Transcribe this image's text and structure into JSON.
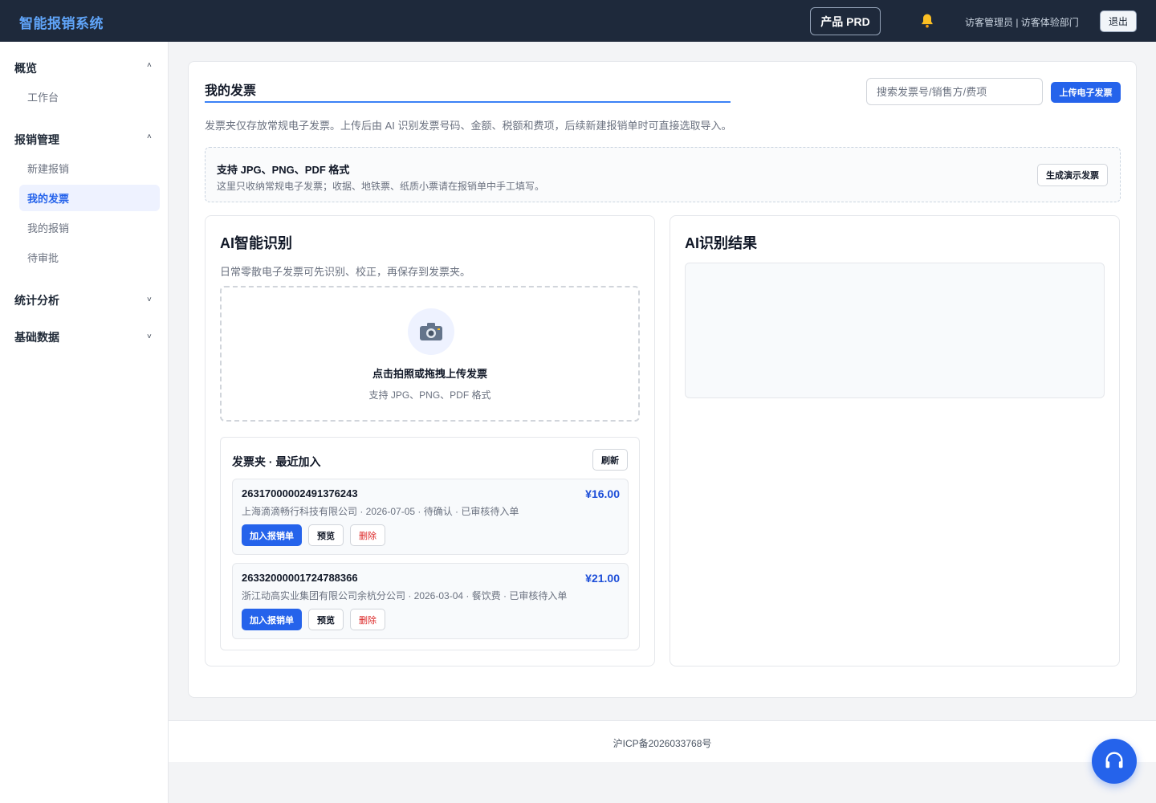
{
  "header": {
    "brand": "智能报销系统",
    "prd_label": "产品 PRD",
    "bell_icon": "bell-icon",
    "user": "访客管理员 | 访客体验部门",
    "logout": "退出"
  },
  "sidebar": {
    "groups": [
      {
        "title": "概览",
        "expanded": true,
        "items": [
          "工作台"
        ]
      },
      {
        "title": "报销管理",
        "expanded": true,
        "items": [
          "新建报销",
          "我的发票",
          "我的报销",
          "待审批"
        ]
      },
      {
        "title": "统计分析",
        "expanded": false,
        "items": []
      },
      {
        "title": "基础数据",
        "expanded": false,
        "items": []
      }
    ],
    "active_item": "我的发票",
    "chev_up": "˄",
    "chev_down": "˅"
  },
  "page": {
    "title": "我的发票",
    "search_placeholder": "搜索发票号/销售方/费项",
    "upload_btn": "上传电子发票",
    "desc": "发票夹仅存放常规电子发票。上传后由 AI 识别发票号码、金额、税额和费项，后续新建报销单时可直接选取导入。",
    "format_title": "支持 JPG、PNG、PDF 格式",
    "format_sub": "这里只收纳常规电子发票；收据、地铁票、纸质小票请在报销单中手工填写。",
    "demo_btn": "生成演示发票"
  },
  "ai_panel": {
    "title": "AI智能识别",
    "desc": "日常零散电子发票可先识别、校正，再保存到发票夹。",
    "drop_title": "点击拍照或拖拽上传发票",
    "drop_sub": "支持 JPG、PNG、PDF 格式",
    "camera_icon": "camera-icon"
  },
  "folder": {
    "title": "发票夹 · 最近加入",
    "refresh": "刷新",
    "invoices": [
      {
        "number": "26317000002491376243",
        "amount": "¥16.00",
        "meta": "上海滴滴畅行科技有限公司 · 2026-07-05 · 待确认 · 已审核待入单",
        "add": "加入报销单",
        "preview": "预览",
        "delete": "删除"
      },
      {
        "number": "26332000001724788366",
        "amount": "¥21.00",
        "meta": "浙江动高实业集团有限公司余杭分公司 · 2026-03-04 · 餐饮费 · 已审核待入单",
        "add": "加入报销单",
        "preview": "预览",
        "delete": "删除"
      }
    ]
  },
  "result_panel": {
    "title": "AI识别结果"
  },
  "footer": {
    "icp": "沪ICP备2026033768号",
    "support_icon": "headset-icon"
  },
  "colors": {
    "primary": "#2563eb",
    "topbar": "#1e293b",
    "brand": "#60a5fa",
    "danger": "#dc2626"
  }
}
